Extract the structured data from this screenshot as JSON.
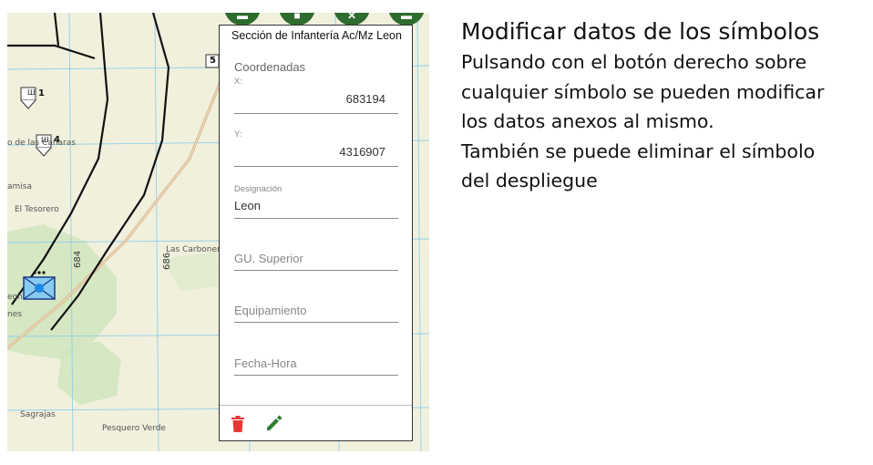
{
  "map": {
    "place_labels": [
      "o de las Cañaras",
      "amisa",
      "El Tesorero",
      "Las Carbonera",
      "eon",
      "nes",
      "Sagrajas",
      "Pesquero Verde"
    ],
    "grid_labels": [
      "684",
      "686"
    ],
    "marker_numbers": [
      "1",
      "4"
    ],
    "road_marker": "5"
  },
  "panel": {
    "title": "Sección de Infantería Ac/Mz Leon",
    "coords_label": "Coordenadas",
    "x_label": "X:",
    "x_value": "683194",
    "y_label": "Y:",
    "y_value": "4316907",
    "designation_label": "Designación",
    "designation_value": "Leon",
    "superior_placeholder": "GU. Superior",
    "equipment_placeholder": "Equipamiento",
    "datetime_placeholder": "Fecha-Hora"
  },
  "colors": {
    "accent_green": "#2e6b2e",
    "delete_red": "#e53935",
    "edit_green": "#2e7d32",
    "symbol_blue": "#87cbee"
  },
  "icons": [
    "trash-icon",
    "pencil-icon",
    "close-icon"
  ],
  "instructions": {
    "title": "Modificar datos de los símbolos",
    "lines": [
      "Pulsando con el botón derecho sobre",
      "cualquier símbolo se pueden modificar",
      "los datos anexos al mismo.",
      "También se puede eliminar el símbolo",
      "del despliegue"
    ]
  }
}
